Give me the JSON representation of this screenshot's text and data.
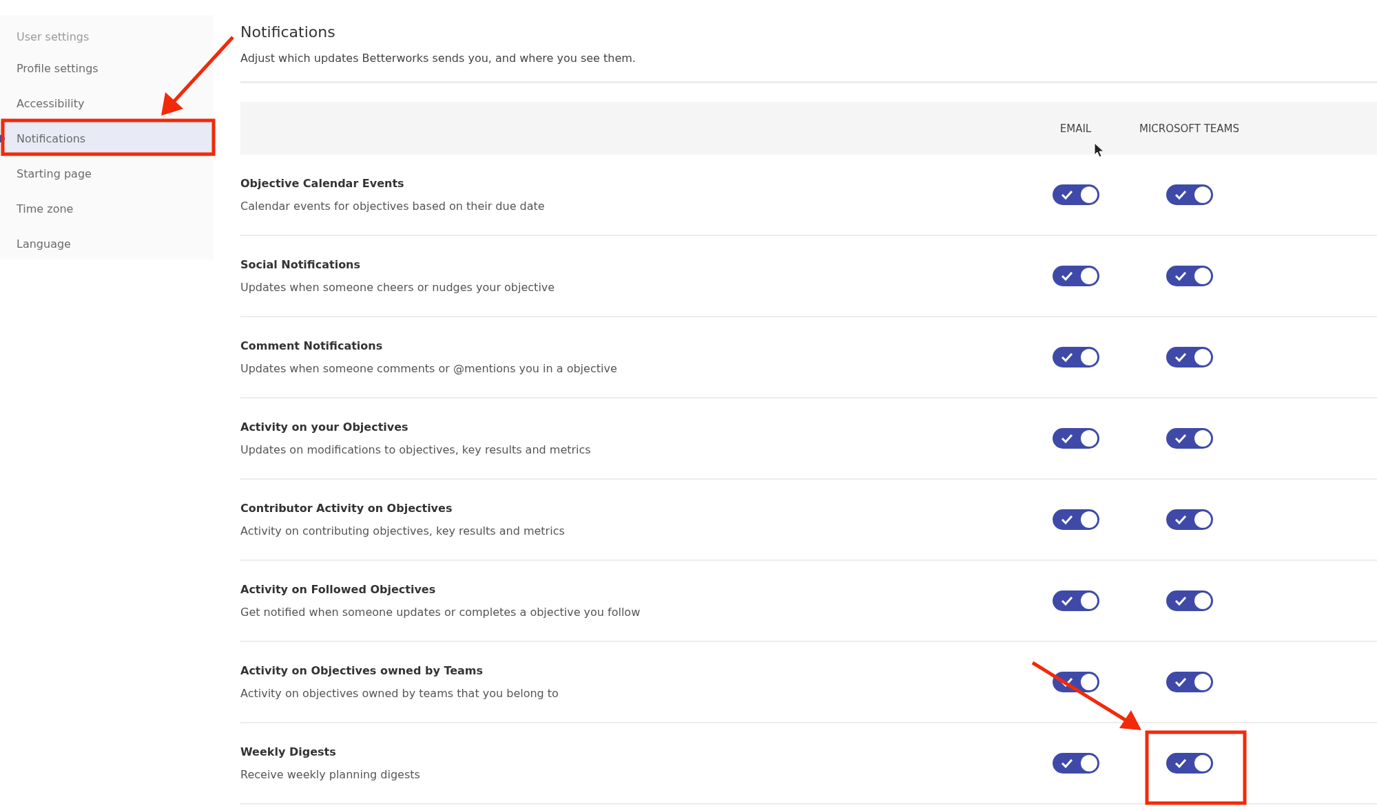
{
  "sidebar": {
    "heading": "User settings",
    "items": [
      {
        "label": "Profile settings",
        "selected": false
      },
      {
        "label": "Accessibility",
        "selected": false
      },
      {
        "label": "Notifications",
        "selected": true
      },
      {
        "label": "Starting page",
        "selected": false
      },
      {
        "label": "Time zone",
        "selected": false
      },
      {
        "label": "Language",
        "selected": false
      }
    ]
  },
  "page": {
    "title": "Notifications",
    "subtitle": "Adjust which updates Betterworks sends you, and where you see them."
  },
  "columns": [
    "EMAIL",
    "MICROSOFT TEAMS"
  ],
  "rows": [
    {
      "title": "Objective Calendar Events",
      "description": "Calendar events for objectives based on their due date",
      "email_on": true,
      "teams_on": true
    },
    {
      "title": "Social Notifications",
      "description": "Updates when someone cheers or nudges your objective",
      "email_on": true,
      "teams_on": true
    },
    {
      "title": "Comment Notifications",
      "description": "Updates when someone comments or @mentions you in a objective",
      "email_on": true,
      "teams_on": true
    },
    {
      "title": "Activity on your Objectives",
      "description": "Updates on modifications to objectives, key results and metrics",
      "email_on": true,
      "teams_on": true
    },
    {
      "title": "Contributor Activity on Objectives",
      "description": "Activity on contributing objectives, key results and metrics",
      "email_on": true,
      "teams_on": true
    },
    {
      "title": "Activity on Followed Objectives",
      "description": "Get notified when someone updates or completes a objective you follow",
      "email_on": true,
      "teams_on": true
    },
    {
      "title": "Activity on Objectives owned by Teams",
      "description": "Activity on objectives owned by teams that you belong to",
      "email_on": true,
      "teams_on": true
    },
    {
      "title": "Weekly Digests",
      "description": "Receive weekly planning digests",
      "email_on": true,
      "teams_on": true
    }
  ]
}
